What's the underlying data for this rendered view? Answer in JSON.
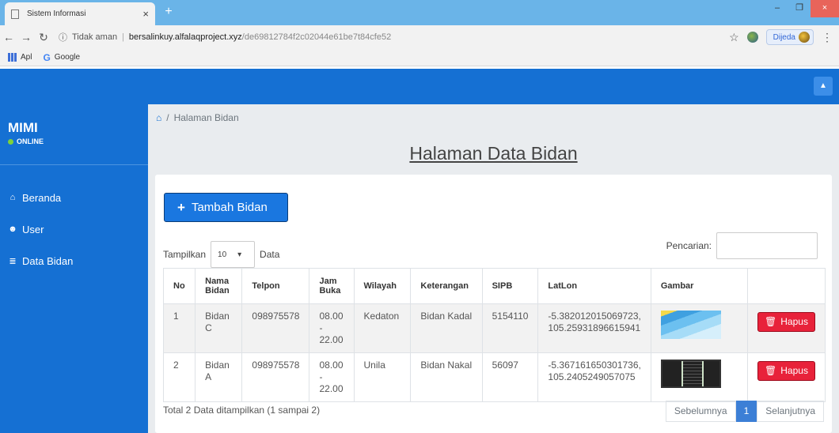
{
  "browser": {
    "tab_title": "Sistem Informasi",
    "security_text": "Tidak aman",
    "url_host": "bersalinkuy.alfalaqproject.xyz",
    "url_path": "/de69812784f2c02044e61be7t84cfe52",
    "profile_name": "Dijeda",
    "bookmarks": [
      {
        "label": "Apl",
        "icon": "apps-icon"
      },
      {
        "label": "Google",
        "icon": "google-icon"
      }
    ]
  },
  "sidebar": {
    "brand": "MIMI",
    "status": "ONLINE",
    "items": [
      {
        "label": "Beranda",
        "icon": "home-icon"
      },
      {
        "label": "User",
        "icon": "users-icon"
      },
      {
        "label": "Data Bidan",
        "icon": "database-icon"
      }
    ]
  },
  "breadcrumb": {
    "current": "Halaman Bidan"
  },
  "page": {
    "title": "Halaman Data Bidan"
  },
  "toolbar": {
    "add_label": "Tambah Bidan"
  },
  "table_controls": {
    "show_label": "Tampilkan",
    "length_value": "10",
    "data_label": "Data",
    "search_label": "Pencarian:"
  },
  "table": {
    "headers": [
      "No",
      "Nama Bidan",
      "Telpon",
      "Jam Buka",
      "Wilayah",
      "Keterangan",
      "SIPB",
      "LatLon",
      "Gambar",
      ""
    ],
    "rows": [
      {
        "no": "1",
        "nama": "Bidan C",
        "telpon": "098975578",
        "jam": "08.00 - 22.00",
        "wilayah": "Kedaton",
        "keterangan": "Bidan Kadal",
        "sipb": "5154110",
        "latlon": "-5.382012015069723, 105.25931896615941",
        "delete_label": "Hapus"
      },
      {
        "no": "2",
        "nama": "Bidan A",
        "telpon": "098975578",
        "jam": "08.00 - 22.00",
        "wilayah": "Unila",
        "keterangan": "Bidan Nakal",
        "sipb": "56097",
        "latlon": "-5.367161650301736, 105.2405249057075",
        "delete_label": "Hapus"
      }
    ]
  },
  "footer": {
    "info": "Total 2 Data ditampilkan (1 sampai 2)",
    "prev": "Sebelumnya",
    "page": "1",
    "next": "Selanjutnya"
  },
  "colors": {
    "primary": "#1570d3",
    "danger": "#e8223a",
    "background": "#e9ecef"
  }
}
